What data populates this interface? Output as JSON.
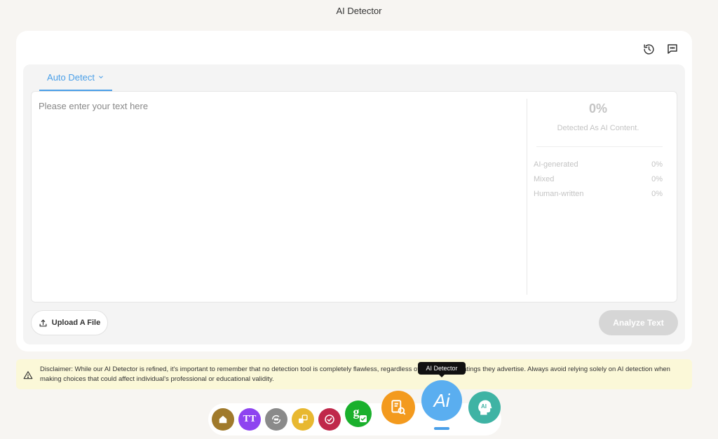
{
  "app": {
    "title": "AI Detector"
  },
  "detector": {
    "tab_label": "Auto Detect",
    "placeholder": "Please enter your text here",
    "result": {
      "percent": "0%",
      "caption": "Detected As AI Content.",
      "rows": [
        {
          "label": "AI-generated",
          "value": "0%"
        },
        {
          "label": "Mixed",
          "value": "0%"
        },
        {
          "label": "Human-written",
          "value": "0%"
        }
      ]
    },
    "upload_label": "Upload A File",
    "analyze_label": "Analyze Text"
  },
  "disclaimer": {
    "text": "Disclaimer: While our AI Detector is refined, it's important to remember that no detection tool is completely flawless, regardless of the accuracy ratings they advertise. Always avoid relying solely on AI detection when making choices that could affect individual's professional or educational validity."
  },
  "dock": {
    "tooltip": "AI Detector",
    "items": [
      {
        "icon": "home-icon",
        "color": "#a07a2c"
      },
      {
        "icon": "text-size-icon",
        "color": "#8e44f0",
        "label": "TT"
      },
      {
        "icon": "paraphrase-icon",
        "color": "#8a8a8a"
      },
      {
        "icon": "translate-icon",
        "color": "#e8b830"
      },
      {
        "icon": "plagiarism-icon",
        "color": "#c0284a"
      },
      {
        "icon": "grammar-check-icon",
        "color": "#1ab02c",
        "label": "g"
      },
      {
        "icon": "document-search-icon",
        "color": "#f39a1e"
      },
      {
        "icon": "ai-detector-icon",
        "color": "#5aaef0",
        "label": "Ai"
      },
      {
        "icon": "ai-humanizer-icon",
        "color": "#3fb3a4",
        "label": "AI"
      }
    ]
  }
}
